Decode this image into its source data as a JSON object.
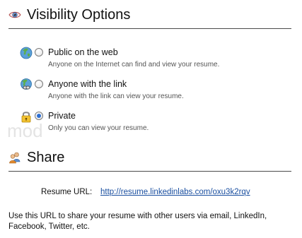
{
  "visibility": {
    "title": "Visibility Options",
    "icon": "eye-icon",
    "options": [
      {
        "id": "public",
        "icon": "globe-icon",
        "label": "Public on the web",
        "description": "Anyone on the Internet can find and view your resume.",
        "selected": false
      },
      {
        "id": "link",
        "icon": "link-globe-icon",
        "label": "Anyone with the link",
        "description": "Anyone with the link can view your resume.",
        "selected": false
      },
      {
        "id": "private",
        "icon": "lock-icon",
        "label": "Private",
        "description": "Only you can view your resume.",
        "selected": true
      }
    ]
  },
  "share": {
    "title": "Share",
    "icon": "people-icon",
    "url_label": "Resume URL:",
    "url": "http://resume.linkedinlabs.com/oxu3k2rqv",
    "help_text": "Use this URL to share your resume with other users via email, LinkedIn, Facebook, Twitter, etc."
  },
  "colors": {
    "link": "#1a4fa0",
    "radio_selected": "#2d6fd2",
    "divider": "#4a4a4a",
    "description_text": "#555555"
  }
}
